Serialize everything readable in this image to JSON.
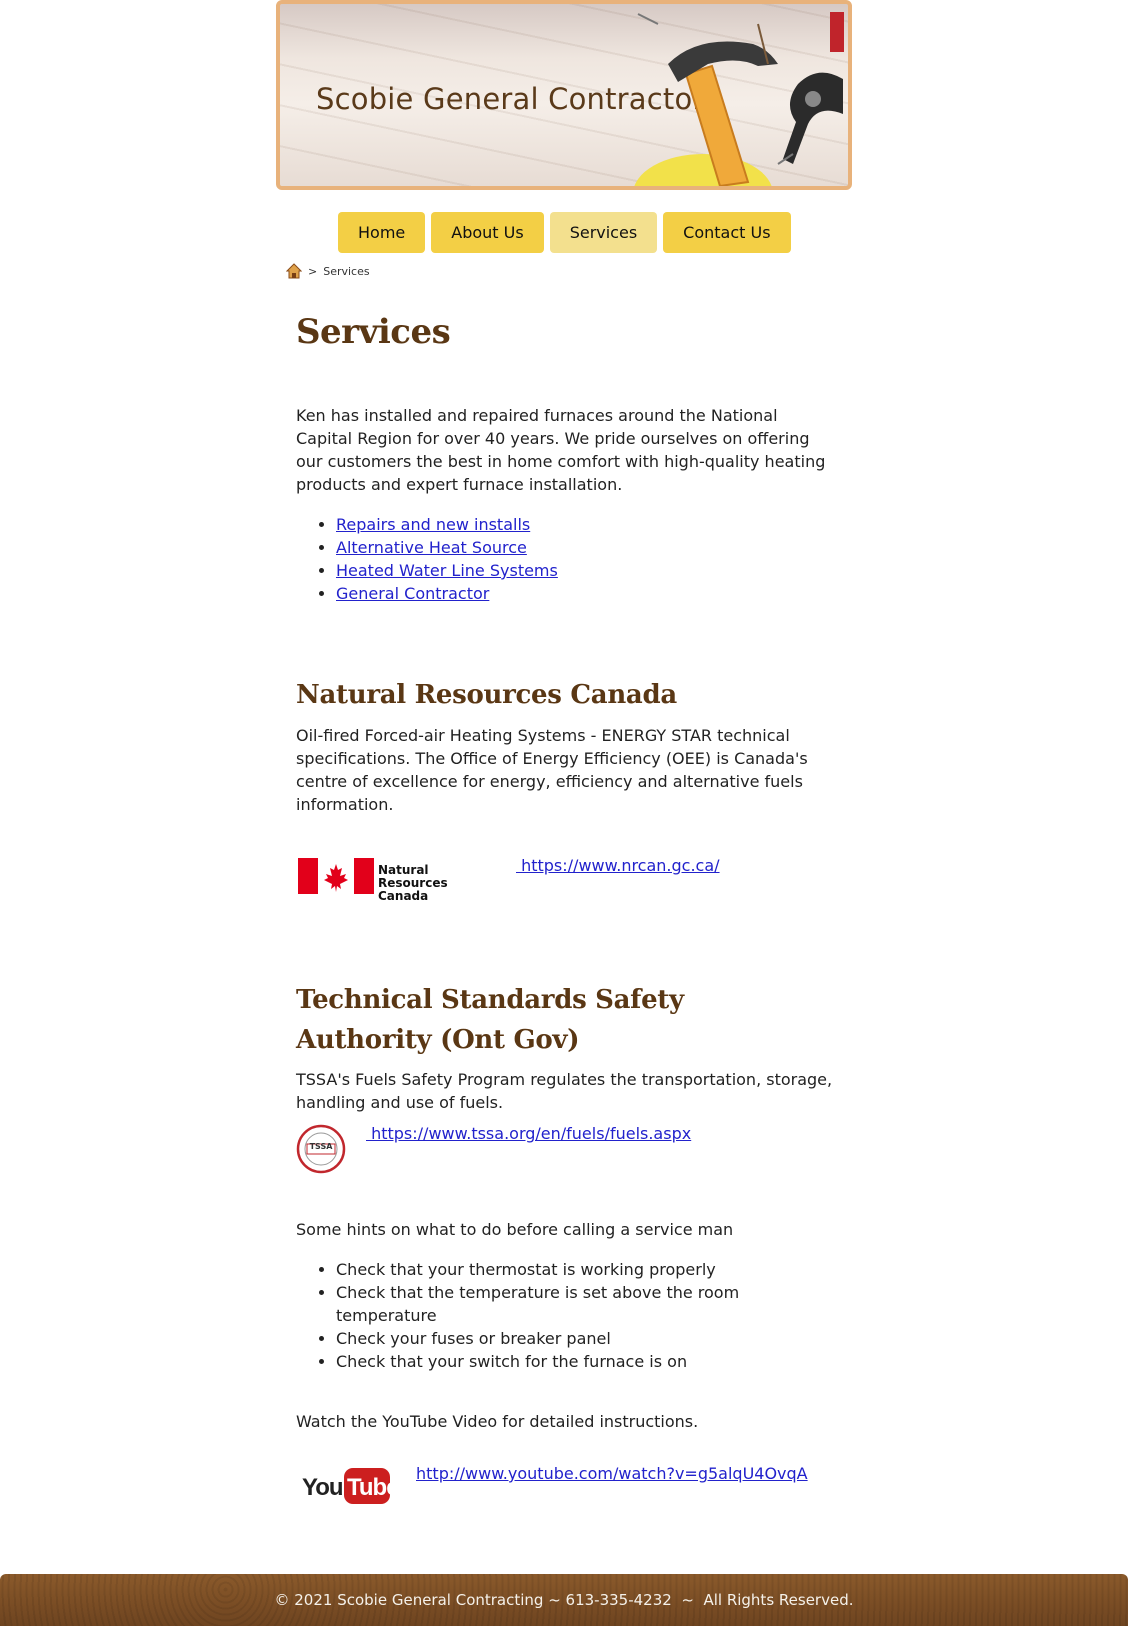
{
  "banner": {
    "title": "Scobie General Contractor"
  },
  "nav": {
    "items": [
      {
        "label": "Home"
      },
      {
        "label": "About Us"
      },
      {
        "label": "Services"
      },
      {
        "label": "Contact Us"
      }
    ],
    "active": "Services"
  },
  "breadcrumb": {
    "separator": ">",
    "current": "Services",
    "home_icon": "home-icon"
  },
  "main": {
    "title": "Services",
    "intro": "Ken has installed and repaired furnaces around the National Capital Region for over 40 years. We pride ourselves on offering our customers the best in home comfort with high-quality heating products and expert furnace installation.",
    "service_links": [
      "Repairs and new installs",
      "Alternative Heat Source",
      "Heated Water Line Systems",
      "General Contractor"
    ]
  },
  "nrcan": {
    "heading": "Natural Resources Canada",
    "text": "Oil-fired Forced-air Heating Systems - ENERGY STAR technical specifications. The Office of Energy Efficiency (OEE) is Canada's centre of excellence for energy, efficiency and alternative fuels information.",
    "logo_text_line1": "Natural Resources",
    "logo_text_line2": "Canada",
    "link": " https://www.nrcan.gc.ca/"
  },
  "tssa": {
    "heading": "Technical Standards Safety Authority (Ont Gov)",
    "text": "TSSA's Fuels Safety Program regulates the transportation, storage, handling and use of fuels.",
    "logo_text": "TSSA",
    "link": " https://www.tssa.org/en/fuels/fuels.aspx"
  },
  "hints": {
    "intro": "Some hints on what to do before calling a service man",
    "items": [
      "Check that your thermostat is working properly",
      "Check that the temperature is set above the room temperature",
      "Check your fuses or breaker panel",
      "Check that your switch for the furnace is on"
    ],
    "video_text": "Watch the YouTube Video for detailed instructions.",
    "youtube_logo": "YouTube",
    "video_link": "http://www.youtube.com/watch?v=g5alqU4OvqA"
  },
  "footer": {
    "text": "© 2021 Scobie General Contracting ~ 613-335-4232  ~  All Rights Reserved."
  },
  "colors": {
    "nav": "#f3cf45",
    "nav_active": "#f3e08e",
    "heading": "#5a3714",
    "link": "#2222cc",
    "footer": "#7a4d24"
  }
}
